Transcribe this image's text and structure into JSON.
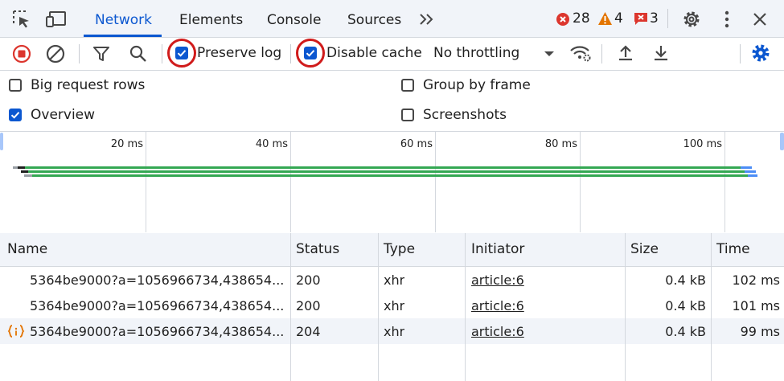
{
  "tabs": {
    "items": [
      "Network",
      "Elements",
      "Console",
      "Sources"
    ],
    "more_label": "»"
  },
  "counts": {
    "errors": "28",
    "warnings": "4",
    "issues": "3"
  },
  "toolbar": {
    "preserve_log": "Preserve log",
    "disable_cache": "Disable cache",
    "throttling": "No throttling"
  },
  "settings": {
    "big_request_rows": "Big request rows",
    "group_by_frame": "Group by frame",
    "overview": "Overview",
    "screenshots": "Screenshots"
  },
  "overview_ticks": [
    "20 ms",
    "40 ms",
    "60 ms",
    "80 ms",
    "100 ms"
  ],
  "table": {
    "columns": [
      "Name",
      "Status",
      "Type",
      "Initiator",
      "Size",
      "Time"
    ],
    "rows": [
      {
        "name": "5364be9000?a=1056966734,438654...",
        "status": "200",
        "type": "xhr",
        "initiator": "article:6",
        "size": "0.4 kB",
        "time": "102 ms"
      },
      {
        "name": "5364be9000?a=1056966734,438654...",
        "status": "200",
        "type": "xhr",
        "initiator": "article:6",
        "size": "0.4 kB",
        "time": "101 ms"
      },
      {
        "name": "5364be9000?a=1056966734,438654...",
        "status": "204",
        "type": "xhr",
        "initiator": "article:6",
        "size": "0.4 kB",
        "time": "99 ms"
      }
    ]
  },
  "colors": {
    "accent": "#0b57d0",
    "error": "#dc362e",
    "warning": "#e37400",
    "highlight_ring": "#d01b1b",
    "timeline_bar": "#34a853"
  }
}
